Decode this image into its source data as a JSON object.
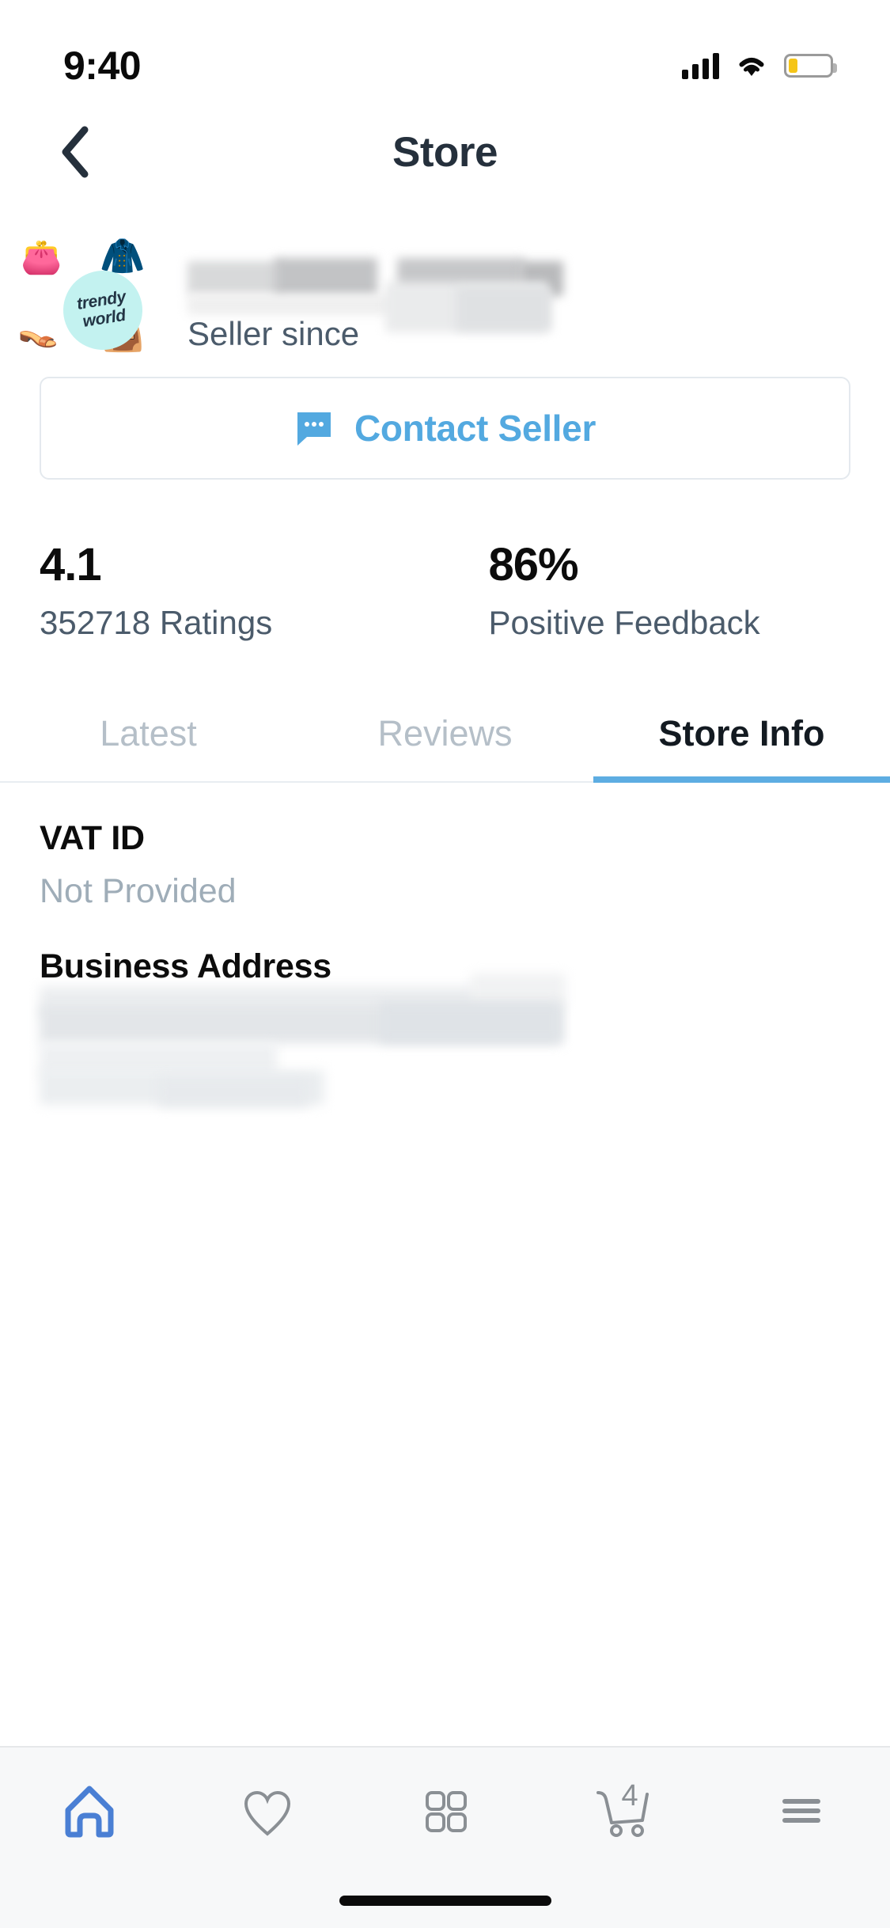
{
  "status_bar": {
    "time": "9:40",
    "signal_icon": "signal-bars-icon",
    "wifi_icon": "wifi-icon",
    "battery_icon": "battery-low-icon",
    "battery_level_pct": 22,
    "battery_color": "#f5c518"
  },
  "header": {
    "back_icon": "chevron-left-icon",
    "title": "Store"
  },
  "seller": {
    "avatar": {
      "logo_line_1": "trendy",
      "logo_line_2": "world",
      "logo_bg_color": "#c3f2f0",
      "decorations": [
        {
          "name": "earrings-icon",
          "glyph": "👛"
        },
        {
          "name": "denim-jacket-icon",
          "glyph": "🧥"
        },
        {
          "name": "shoes-icon",
          "glyph": "👡"
        },
        {
          "name": "handbag-icon",
          "glyph": "👜"
        }
      ]
    },
    "name_redacted": true,
    "since_label": "Seller since",
    "since_value_redacted": true
  },
  "contact": {
    "icon": "chat-bubble-icon",
    "label": "Contact Seller",
    "accent_color": "#53a9e0"
  },
  "stats": [
    {
      "value": "4.1",
      "label": "352718 Ratings"
    },
    {
      "value": "86%",
      "label": "Positive Feedback"
    }
  ],
  "tabs": {
    "items": [
      {
        "label": "Latest",
        "active": false
      },
      {
        "label": "Reviews",
        "active": false
      },
      {
        "label": "Store Info",
        "active": true
      }
    ],
    "active_underline_color": "#5dade2",
    "inactive_color": "#b5bfc8"
  },
  "store_info": {
    "vat": {
      "heading": "VAT ID",
      "value": "Not Provided"
    },
    "address": {
      "heading": "Business Address",
      "value_redacted": true
    }
  },
  "bottom_nav": {
    "items": [
      {
        "name": "home",
        "icon": "home-icon",
        "active": true
      },
      {
        "name": "wishlist",
        "icon": "heart-icon",
        "active": false
      },
      {
        "name": "categories",
        "icon": "grid-icon",
        "active": false
      },
      {
        "name": "cart",
        "icon": "shopping-cart-icon",
        "active": false,
        "badge": "4"
      },
      {
        "name": "menu",
        "icon": "hamburger-menu-icon",
        "active": false
      }
    ],
    "active_color": "#4a7fd4",
    "inactive_color": "#8a8f94"
  }
}
